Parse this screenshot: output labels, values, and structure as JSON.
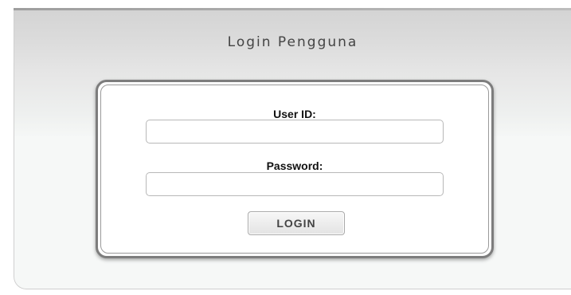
{
  "login": {
    "title": "Login Pengguna",
    "user_id": {
      "label": "User ID:",
      "value": "",
      "placeholder": ""
    },
    "password": {
      "label": "Password:",
      "value": "",
      "placeholder": ""
    },
    "login_button_label": "LOGIN"
  }
}
